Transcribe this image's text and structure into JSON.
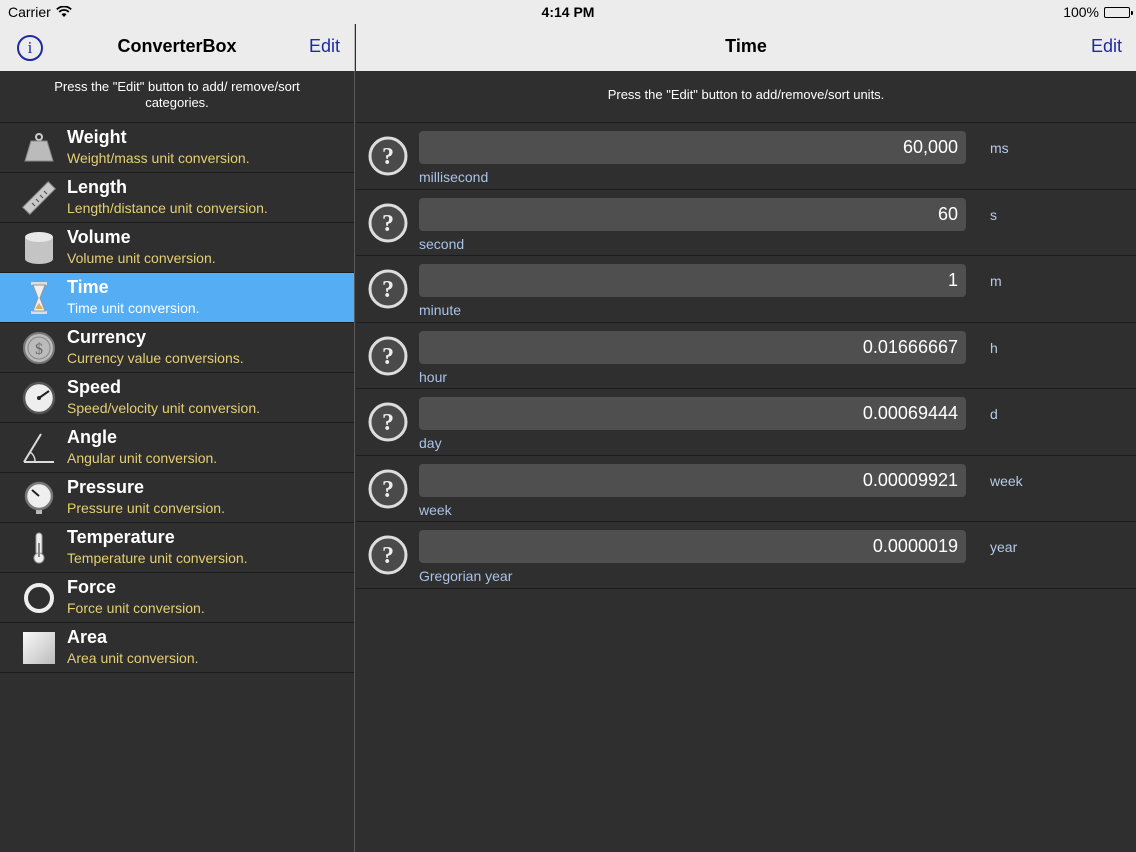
{
  "status_bar": {
    "carrier": "Carrier",
    "time": "4:14 PM",
    "battery": "100%"
  },
  "left_nav": {
    "title": "ConverterBox",
    "edit_label": "Edit",
    "info_label": "i"
  },
  "right_nav": {
    "title": "Time",
    "edit_label": "Edit"
  },
  "left_hint": "Press the \"Edit\" button to add/ remove/sort categories.",
  "right_hint": "Press the \"Edit\" button to add/remove/sort units.",
  "categories": [
    {
      "name": "Weight",
      "desc": "Weight/mass unit conversion.",
      "icon": "weight-icon"
    },
    {
      "name": "Length",
      "desc": "Length/distance unit conversion.",
      "icon": "ruler-icon"
    },
    {
      "name": "Volume",
      "desc": "Volume unit conversion.",
      "icon": "cylinder-icon"
    },
    {
      "name": "Time",
      "desc": "Time unit conversion.",
      "icon": "hourglass-icon",
      "selected": true
    },
    {
      "name": "Currency",
      "desc": "Currency value conversions.",
      "icon": "coin-icon"
    },
    {
      "name": "Speed",
      "desc": "Speed/velocity unit conversion.",
      "icon": "speedometer-icon"
    },
    {
      "name": "Angle",
      "desc": "Angular unit conversion.",
      "icon": "angle-icon"
    },
    {
      "name": "Pressure",
      "desc": "Pressure unit conversion.",
      "icon": "pressure-gauge-icon"
    },
    {
      "name": "Temperature",
      "desc": "Temperature unit conversion.",
      "icon": "thermometer-icon"
    },
    {
      "name": "Force",
      "desc": "Force unit conversion.",
      "icon": "ring-icon"
    },
    {
      "name": "Area",
      "desc": "Area unit conversion.",
      "icon": "square-icon"
    }
  ],
  "units": [
    {
      "value": "60,000",
      "name": "millisecond",
      "abbr": "ms"
    },
    {
      "value": "60",
      "name": "second",
      "abbr": "s"
    },
    {
      "value": "1",
      "name": "minute",
      "abbr": "m"
    },
    {
      "value": "0.01666667",
      "name": "hour",
      "abbr": "h"
    },
    {
      "value": "0.00069444",
      "name": "day",
      "abbr": "d"
    },
    {
      "value": "0.00009921",
      "name": "week",
      "abbr": "week"
    },
    {
      "value": "0.0000019",
      "name": "Gregorian year",
      "abbr": "year"
    }
  ],
  "colors": {
    "accent": "#1d2aa8",
    "selected_row": "#55adf4",
    "desc_text": "#e6cf72",
    "unit_name_text": "#a9c3e8"
  }
}
